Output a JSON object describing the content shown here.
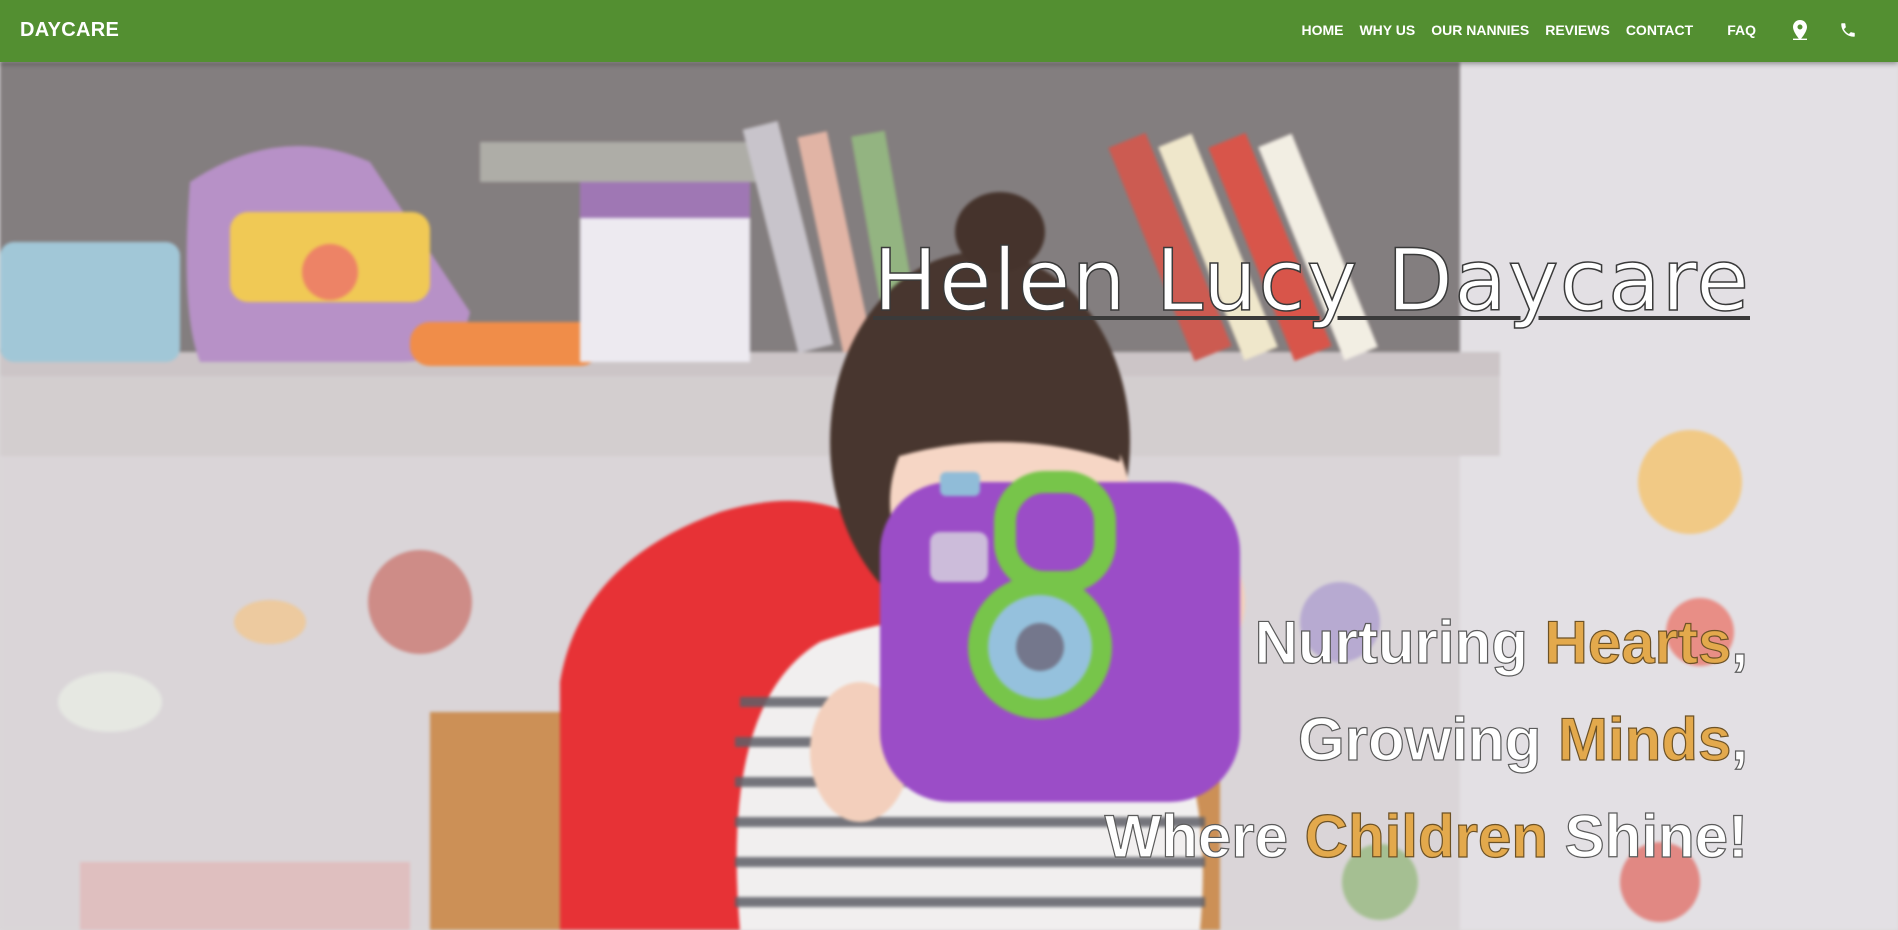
{
  "navbar": {
    "brand": "DAYCARE",
    "items": [
      {
        "label": "HOME"
      },
      {
        "label": "WHY US"
      },
      {
        "label": "OUR NANNIES"
      },
      {
        "label": "REVIEWS"
      },
      {
        "label": "CONTACT"
      },
      {
        "label": "FAQ"
      }
    ],
    "icons": [
      "location-pin-icon",
      "phone-icon"
    ]
  },
  "hero": {
    "title": "Helen Lucy Daycare",
    "tagline": {
      "line1": {
        "pre": "Nurturing ",
        "highlight": "Hearts",
        "post": ","
      },
      "line2": {
        "pre": "Growing ",
        "highlight": "Minds",
        "post": ","
      },
      "line3": {
        "pre": "Where ",
        "highlight": "Children",
        "post": " Shine!"
      }
    }
  },
  "colors": {
    "navbar_bg": "#538f31",
    "highlight": "#e3a94c",
    "text": "#ffffff"
  }
}
